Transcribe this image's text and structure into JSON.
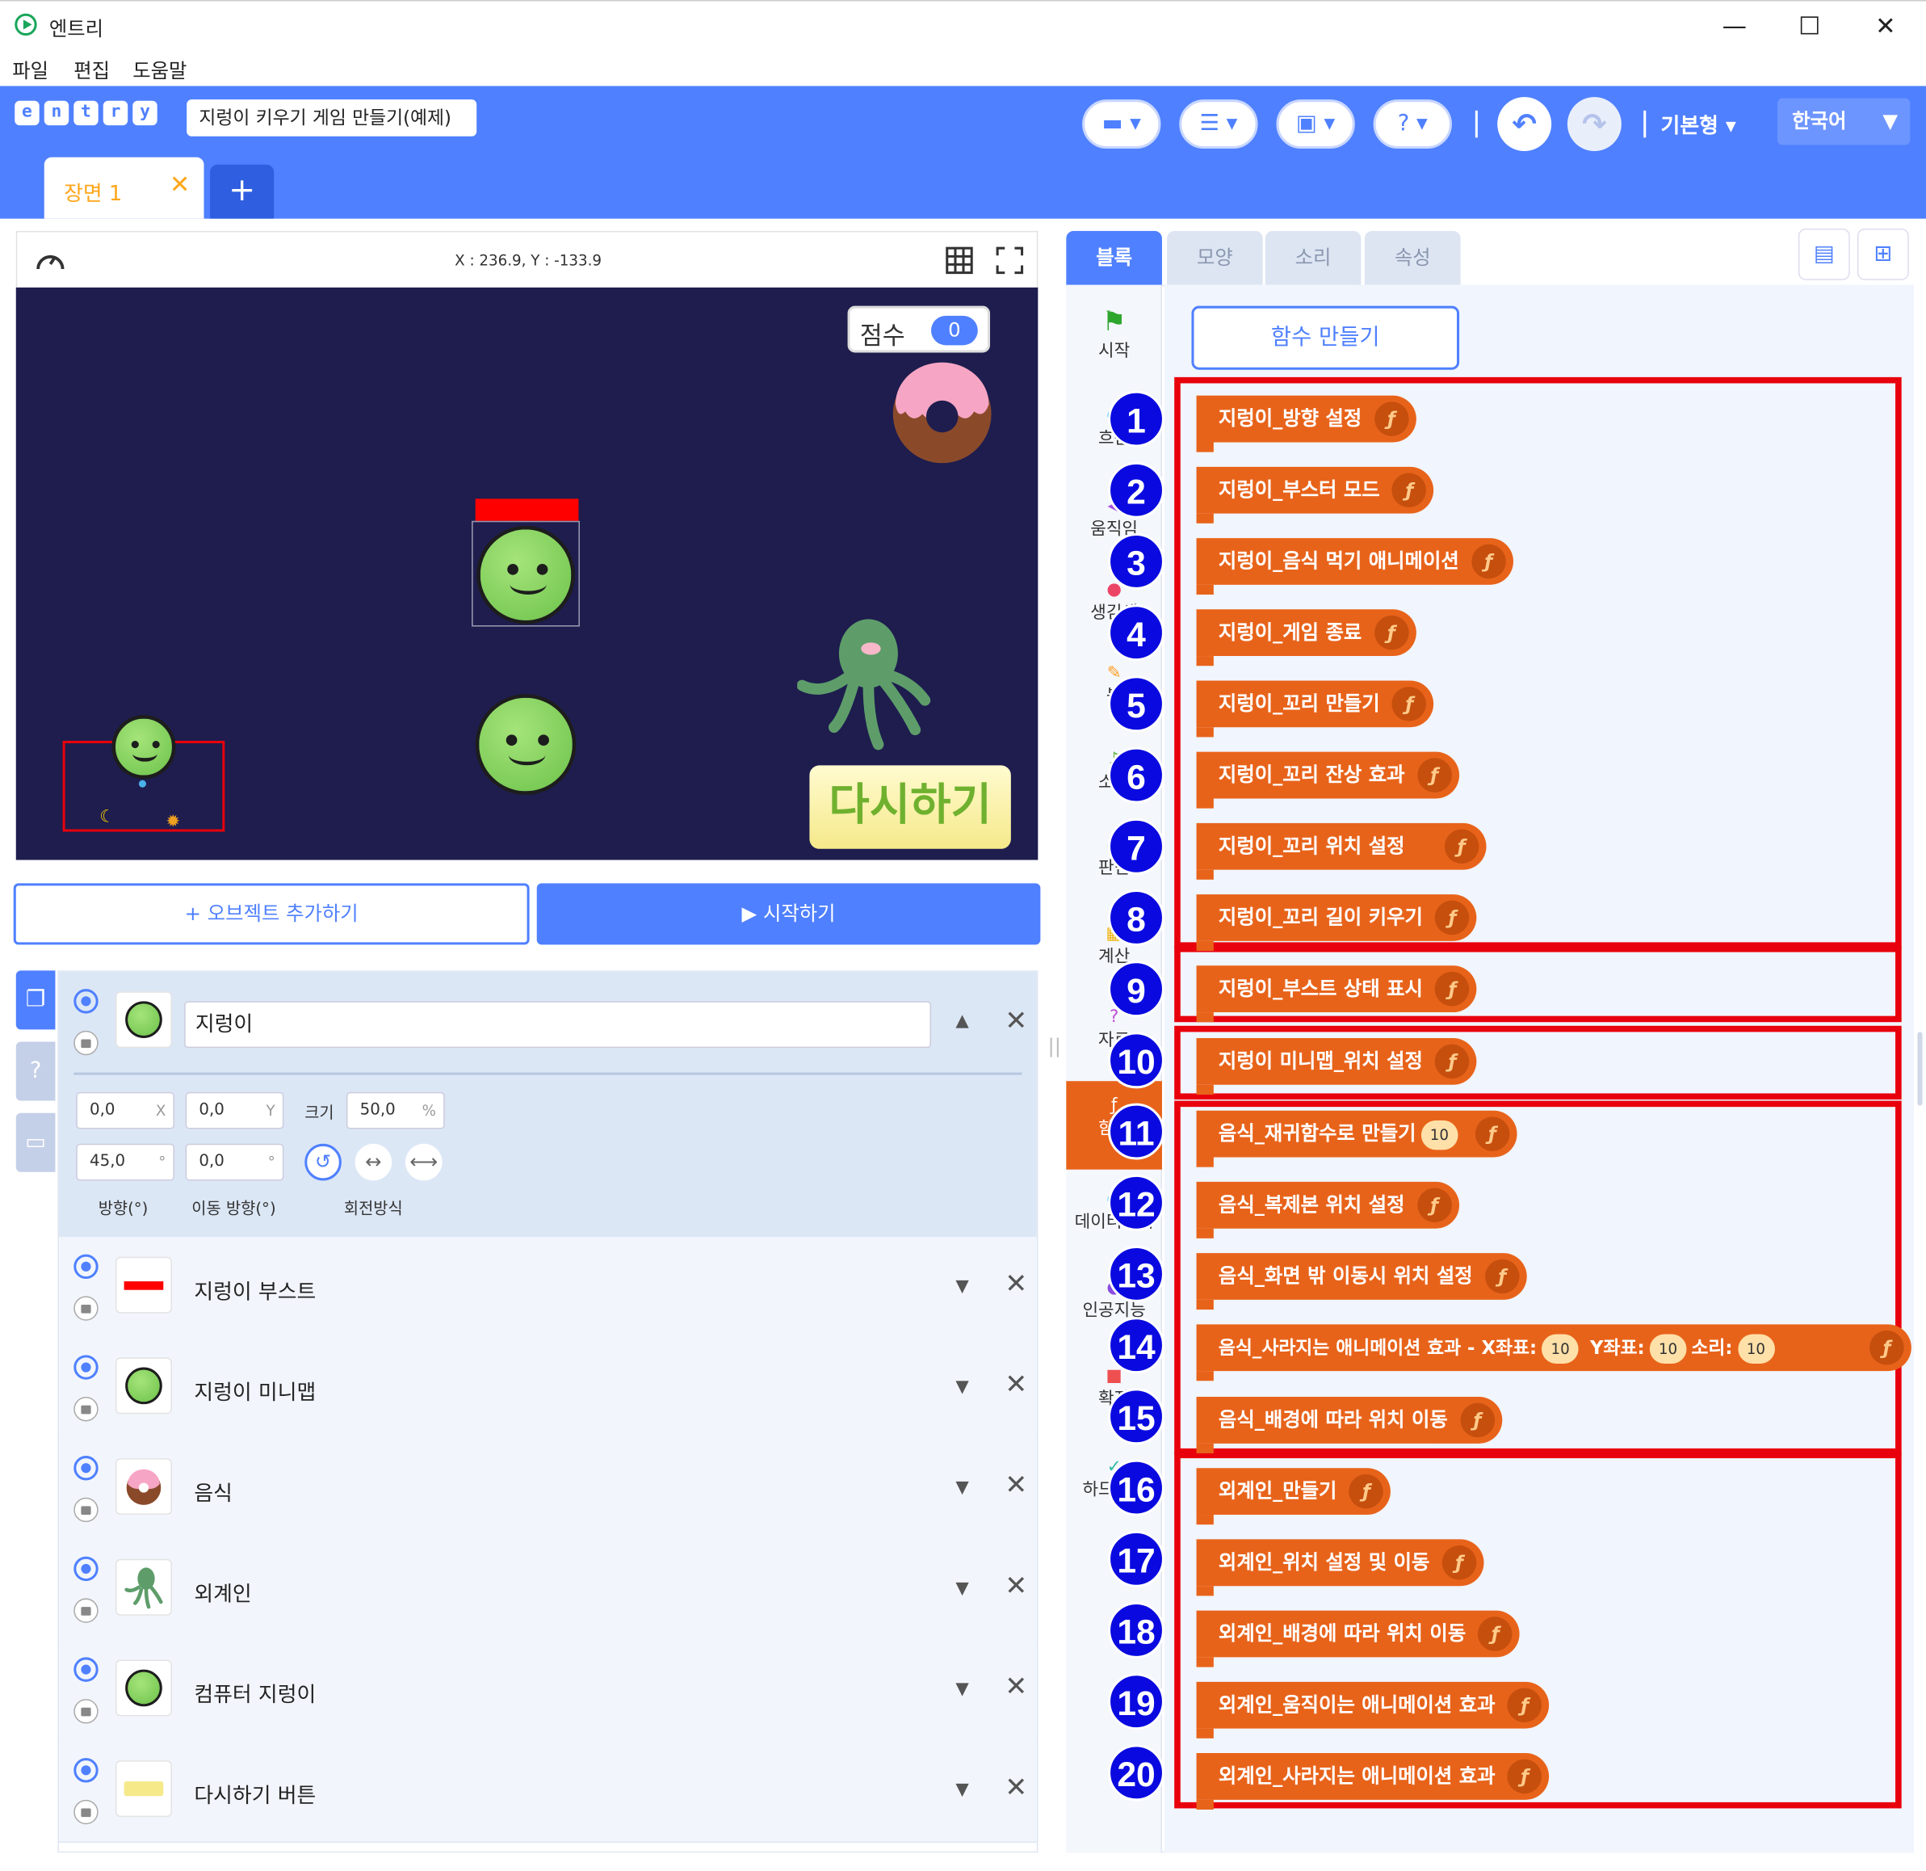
{
  "window": {
    "title": "엔트리",
    "minimize": "—",
    "maximize": "☐",
    "close": "✕"
  },
  "menu": [
    "파일",
    "편집",
    "도움말"
  ],
  "header": {
    "logo_letters": [
      "e",
      "n",
      "t",
      "r",
      "y"
    ],
    "project_title": "지렁이 키우기 게임 만들기(예제)",
    "mode": "기본형 ▾",
    "language": "한국어",
    "language_arrow": "▼"
  },
  "scene": {
    "tab_label": "장면 1",
    "tab_close": "✕",
    "add": "+"
  },
  "stage": {
    "coords": "X : 236.9, Y : -133.9",
    "score_label": "점수",
    "score_value": "0",
    "restart_label": "다시하기"
  },
  "buttons": {
    "add_object": "+ 오브젝트 추가하기",
    "start": "▶ 시작하기"
  },
  "selected_object": {
    "name": "지렁이",
    "x": "0,0",
    "x_unit": "X",
    "y": "0,0",
    "y_unit": "Y",
    "size_label": "크기",
    "size": "50,0",
    "size_unit": "%",
    "direction": "45,0",
    "direction_unit": "°",
    "move_direction": "0,0",
    "move_direction_unit": "°",
    "direction_label": "방향(°)",
    "move_direction_label": "이동 방향(°)",
    "rotation_label": "회전방식"
  },
  "objects": [
    {
      "name": "지렁이 부스트"
    },
    {
      "name": "지렁이 미니맵"
    },
    {
      "name": "음식"
    },
    {
      "name": "외계인"
    },
    {
      "name": "컴퓨터 지렁이"
    },
    {
      "name": "다시하기 버튼"
    }
  ],
  "right_tabs": [
    "블록",
    "모양",
    "소리",
    "속성"
  ],
  "categories": [
    "시작",
    "흐름",
    "움직임",
    "생김새",
    "붓",
    "소리",
    "판단",
    "계산",
    "자료",
    "함수",
    "데이터분석",
    "인공지능",
    "확장",
    "하드웨어"
  ],
  "function_create": "함수 만들기",
  "blocks": [
    {
      "n": "1",
      "label": "지렁이_방향 설정"
    },
    {
      "n": "2",
      "label": "지렁이_부스터 모드"
    },
    {
      "n": "3",
      "label": "지렁이_음식 먹기 애니메이션"
    },
    {
      "n": "4",
      "label": "지렁이_게임 종료"
    },
    {
      "n": "5",
      "label": "지렁이_꼬리 만들기"
    },
    {
      "n": "6",
      "label": "지렁이_꼬리 잔상 효과"
    },
    {
      "n": "7",
      "label": "지렁이_꼬리 위치 설정"
    },
    {
      "n": "8",
      "label": "지렁이_꼬리 길이 키우기"
    },
    {
      "n": "9",
      "label": "지렁이_부스트 상태 표시"
    },
    {
      "n": "10",
      "label": "지렁이 미니맵_위치 설정"
    },
    {
      "n": "11",
      "label": "음식_재귀함수로 만들기",
      "pill": "10"
    },
    {
      "n": "12",
      "label": "음식_복제본 위치 설정"
    },
    {
      "n": "13",
      "label": "음식_화면 밖 이동시 위치 설정"
    },
    {
      "n": "14",
      "label": "음식_사라지는 애니메이션 효과 - X좌표:",
      "pill": "10",
      "label2": "Y좌표:",
      "pill2": "10",
      "label3": "소리:",
      "pill3": "10"
    },
    {
      "n": "15",
      "label": "음식_배경에 따라 위치 이동"
    },
    {
      "n": "16",
      "label": "외계인_만들기"
    },
    {
      "n": "17",
      "label": "외계인_위치 설정 및 이동"
    },
    {
      "n": "18",
      "label": "외계인_배경에 따라 위치 이동"
    },
    {
      "n": "19",
      "label": "외계인_움직이는 애니메이션 효과"
    },
    {
      "n": "20",
      "label": "외계인_사라지는 애니메이션 효과"
    }
  ],
  "block_icon": "ƒ",
  "colors": {
    "brand": "#4f80ff",
    "function_block": "#e8631a",
    "highlight": "#e8000c",
    "badge": "#0a0ae0"
  }
}
